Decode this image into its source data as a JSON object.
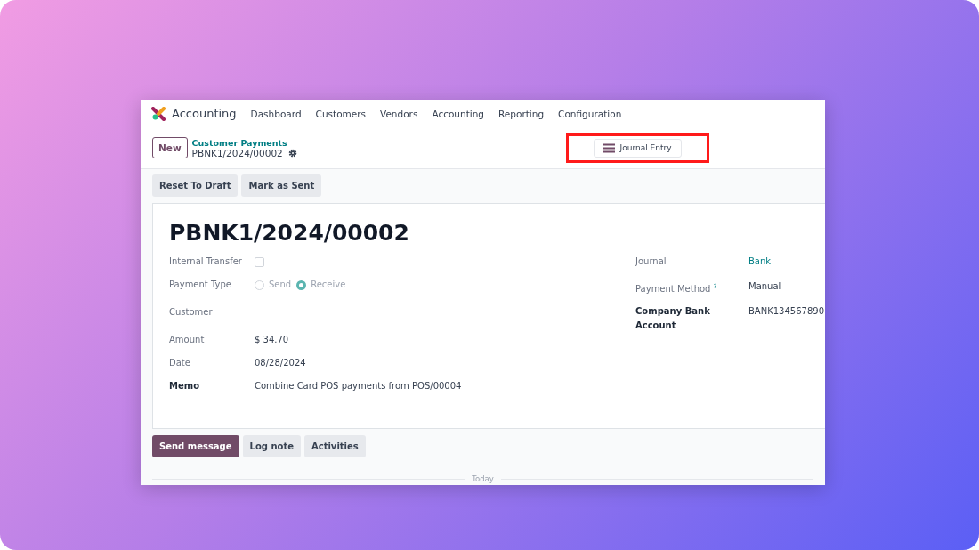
{
  "navbar": {
    "app_name": "Accounting",
    "menu": [
      "Dashboard",
      "Customers",
      "Vendors",
      "Accounting",
      "Reporting",
      "Configuration"
    ]
  },
  "control_panel": {
    "new_button": "New",
    "breadcrumb": "Customer Payments",
    "record": "PBNK1/2024/00002",
    "smart_button": {
      "label": "Journal Entry",
      "highlighted": true
    }
  },
  "status_buttons": [
    "Reset To Draft",
    "Mark as Sent"
  ],
  "form": {
    "title": "PBNK1/2024/00002",
    "left_fields": [
      {
        "kind": "checkbox",
        "label": "Internal Transfer",
        "checked": false,
        "bold": false
      },
      {
        "kind": "radio",
        "label": "Payment Type",
        "options": [
          {
            "label": "Send",
            "selected": false
          },
          {
            "label": "Receive",
            "selected": true
          }
        ],
        "bold": false
      },
      {
        "kind": "text",
        "label": "Customer",
        "bold": false
      },
      {
        "kind": "text",
        "label": "Amount",
        "value": "$ 34.70",
        "bold": false
      },
      {
        "kind": "text",
        "label": "Date",
        "value": "08/28/2024",
        "bold": false
      },
      {
        "kind": "text",
        "label": "Memo",
        "value": "Combine Card POS payments from POS/00004",
        "bold": true
      }
    ],
    "right_fields": [
      {
        "label": "Journal",
        "value": "Bank",
        "link": true,
        "bold": false
      },
      {
        "label": "Payment Method",
        "help": "?",
        "value": "Manual",
        "link": false,
        "bold": false
      },
      {
        "label": "Company Bank Account",
        "value": "BANK134567890",
        "link": false,
        "bold": true
      }
    ]
  },
  "chatter": {
    "buttons": [
      {
        "label": "Send message",
        "primary": true
      },
      {
        "label": "Log note",
        "primary": false
      },
      {
        "label": "Activities",
        "primary": false
      }
    ],
    "divider": "Today"
  }
}
